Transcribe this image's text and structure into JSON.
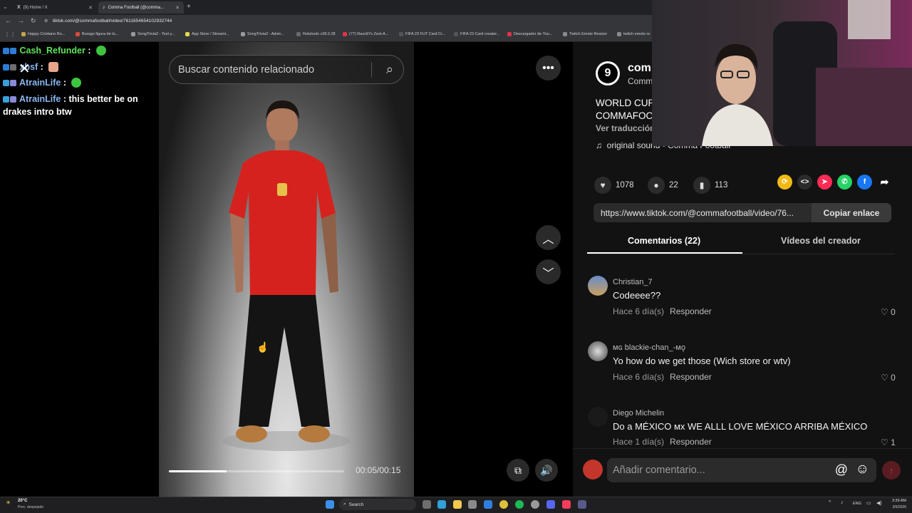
{
  "browser": {
    "tabs": [
      {
        "label": "(9) Home / X"
      },
      {
        "label": "Comma Football (@comma..."
      }
    ],
    "url": "tiktok.com/@commafootball/video/7611654654102932744",
    "bookmarks": [
      "Happy Cristiano Ro...",
      "Burago figura de to...",
      "SongTrivia2 - Test y...",
      "App Store / Streami...",
      "SongTrivia2 - Advin...",
      "Relotools v28.0.28",
      "(77) Razo97s Zest-A...",
      "FIFA 23 FUT Card Cr...",
      "FIFA 23 Card creator...",
      "Descargador de You...",
      "Twitch Emote Resizer",
      "twitch emote re"
    ]
  },
  "chat": [
    {
      "user": "Cash_Refunder",
      "message": ""
    },
    {
      "user": "xbsf",
      "message": ""
    },
    {
      "user": "AtrainLife",
      "message": ""
    },
    {
      "user": "AtrainLife",
      "message": "this better be on drakes intro btw"
    }
  ],
  "video": {
    "search_placeholder": "Buscar contenido relacionado",
    "time": "00:05/00:15",
    "progress": 0.33
  },
  "author": {
    "name": "comm",
    "sub": "Comm",
    "logo_glyph": "9"
  },
  "description": {
    "line1": "WORLD CUP",
    "line2": "COMMAFOO",
    "translate": "Ver traducción",
    "sound": "original sound - Comma Football"
  },
  "stats": {
    "likes": "1078",
    "comments": "22",
    "saves": "113"
  },
  "link": {
    "url": "https://www.tiktok.com/@commafootball/video/76...",
    "copy": "Copiar enlace"
  },
  "tabs": {
    "comments": "Comentarios (22)",
    "creator": "Vídeos del creador"
  },
  "comments": [
    {
      "name": "Christian_7",
      "text": "Codeeee??",
      "time": "Hace 6 día(s)",
      "reply": "Responder",
      "likes": "0"
    },
    {
      "name": "ᴍɢ blackie-chan_-ᴍǫ",
      "text": "Yo how do we get those (Wich store or wtv)",
      "time": "Hace 6 día(s)",
      "reply": "Responder",
      "likes": "0"
    },
    {
      "name": "Diego Michelin",
      "text": "Do a MÉXICO ᴍx WE ALLL LOVE MÉXICO ARRIBA MÉXICO",
      "time": "Hace 1 día(s)",
      "reply": "Responder",
      "likes": "1"
    }
  ],
  "comment_input": {
    "placeholder": "Añadir comentario..."
  },
  "taskbar": {
    "weather_temp": "20°C",
    "weather_desc": "Prec. despejado",
    "search": "Search",
    "lang": "ENG",
    "time": "3:39 AM",
    "date": "3/6/2026"
  }
}
